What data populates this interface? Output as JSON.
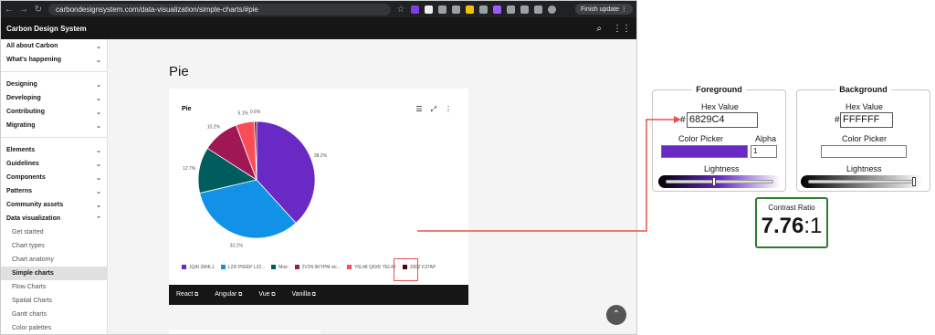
{
  "browser": {
    "url": "carbondesignsystem.com/data-visualization/simple-charts/#pie",
    "finish_update": "Finish update"
  },
  "topbar": {
    "title": "Carbon Design System"
  },
  "sidebar": {
    "groups": [
      [
        "All about Carbon",
        "What's happening"
      ],
      [
        "Designing",
        "Developing",
        "Contributing",
        "Migrating"
      ],
      [
        "Elements",
        "Guidelines",
        "Components",
        "Patterns",
        "Community assets",
        "Data visualization"
      ]
    ],
    "subitems": [
      "Get started",
      "Chart types",
      "Chart anatomy",
      "Simple charts",
      "Flow Charts",
      "Spatial Charts",
      "Gantt charts",
      "Color palettes"
    ],
    "active": "Simple charts"
  },
  "page": {
    "title": "Pie",
    "card_title": "Pie",
    "footer_links": [
      "React",
      "Angular",
      "Vue",
      "Vanilla"
    ]
  },
  "chart_data": {
    "type": "pie",
    "title": "Pie",
    "slices": [
      {
        "label": "JQAI 2M4L1",
        "value": 38.2,
        "color": "#6929C4"
      },
      {
        "label": "L22I P66EP L22...",
        "value": 33.1,
        "color": "#1192E8"
      },
      {
        "label": "Misc",
        "value": 12.7,
        "color": "#005D5D"
      },
      {
        "label": "2V2N 9KYPM vic...",
        "value": 10.2,
        "color": "#9F1853"
      },
      {
        "label": "Y6L48 Q6XK YEL48",
        "value": 5.1,
        "color": "#FA4D56"
      },
      {
        "label": "J9DZ F37AP",
        "value": 0.6,
        "color": "#570408"
      }
    ],
    "data_labels": [
      "38.2%",
      "33.1%",
      "12.7%",
      "10.2%",
      "5.1%",
      "0.6%"
    ],
    "legend": "bottom"
  },
  "foreground": {
    "title": "Foreground",
    "hex_label": "Hex Value",
    "hash": "#",
    "hex": "6829C4",
    "picker_label": "Color Picker",
    "alpha_label": "Alpha",
    "alpha": "1",
    "lightness_label": "Lightness",
    "color": "#6829C4",
    "lightness": 0.45
  },
  "background": {
    "title": "Background",
    "hex_label": "Hex Value",
    "hash": "#",
    "hex": "FFFFFF",
    "picker_label": "Color Picker",
    "lightness_label": "Lightness",
    "color": "#FFFFFF",
    "lightness": 1.0
  },
  "contrast": {
    "label": "Contrast Ratio",
    "ratio": "7.76",
    "suffix": ":1"
  }
}
